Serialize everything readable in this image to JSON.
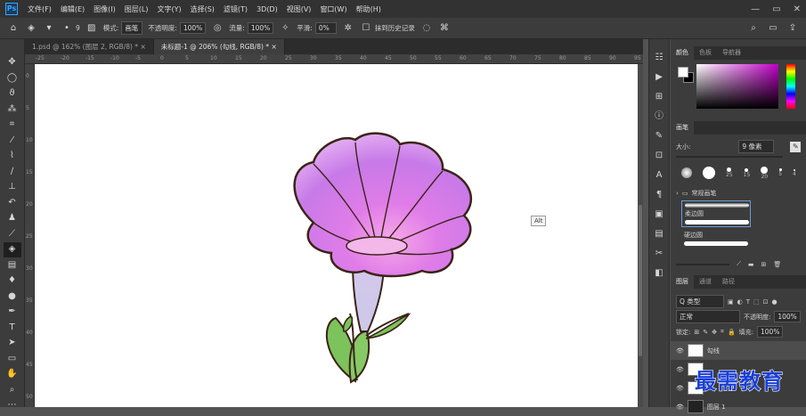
{
  "menubar": {
    "logo": "Ps",
    "items": [
      "文件(F)",
      "编辑(E)",
      "图像(I)",
      "图层(L)",
      "文字(Y)",
      "选择(S)",
      "滤镜(T)",
      "3D(D)",
      "视图(V)",
      "窗口(W)",
      "帮助(H)"
    ],
    "win_min": "—",
    "win_max": "▭",
    "win_close": "✕"
  },
  "options": {
    "brush_size": "9",
    "mode_label": "模式:",
    "mode_value": "画笔",
    "opacity_label": "不透明度:",
    "opacity_value": "100%",
    "flow_label": "流量:",
    "flow_value": "100%",
    "smooth_label": "平滑:",
    "smooth_value": "0%",
    "erase_history": "抹到历史记录"
  },
  "tabs": [
    {
      "label": "1.psd @ 162% (图层 2, RGB/8) *"
    },
    {
      "label": "未标题-1 @ 206% (勾线, RGB/8) *"
    }
  ],
  "tab_close": "×",
  "ruler_top": [
    "-25",
    "-20",
    "-15",
    "-10",
    "-5",
    "0",
    "5",
    "10",
    "15",
    "20",
    "25",
    "30",
    "35",
    "40",
    "45",
    "50",
    "55",
    "60",
    "65",
    "70",
    "75",
    "80",
    "85",
    "90",
    "95"
  ],
  "ruler_left": [
    "0",
    "5",
    "10",
    "15",
    "20",
    "25",
    "30",
    "35",
    "40",
    "45",
    "50"
  ],
  "tooltip": "Alt",
  "color_panel": {
    "tabs": [
      "颜色",
      "色板",
      "导航器"
    ],
    "fg": "#ffffff",
    "bg": "#000000",
    "hue_color": "#c000c8"
  },
  "brush_panel": {
    "title": "画笔",
    "size_label": "大小:",
    "size_value": "9 像素",
    "sizes": [
      "25",
      "15",
      "20",
      "5",
      "4"
    ],
    "group": "常规画笔",
    "items": [
      "柔边圆",
      "硬边圆"
    ]
  },
  "layers_panel": {
    "tabs": [
      "图层",
      "通道",
      "路径"
    ],
    "filter": "Q 类型",
    "mode": "正常",
    "opacity_label": "不透明度:",
    "opacity_value": "100%",
    "lock_label": "锁定:",
    "fill_label": "填充:",
    "fill_value": "100%",
    "layers": [
      {
        "name": "勾线",
        "selected": true
      },
      {
        "name": "",
        "selected": false
      },
      {
        "name": "",
        "selected": false
      },
      {
        "name": "图层 1",
        "selected": false
      }
    ]
  },
  "watermark": "最需教育",
  "colors": {
    "petal": "#d87ee8",
    "petal_light": "#f1c2f7",
    "tube": "#c9c3e3",
    "leaf": "#7bc35b",
    "outline": "#3a2418"
  }
}
